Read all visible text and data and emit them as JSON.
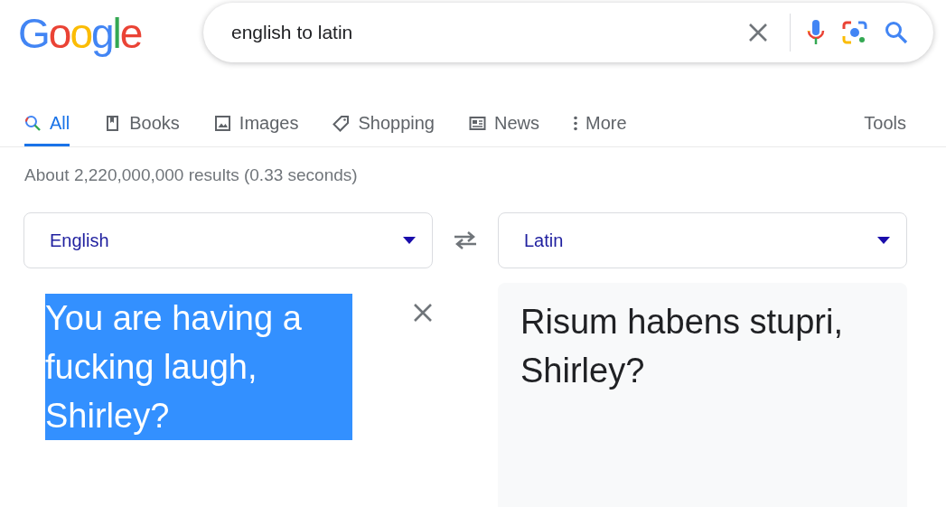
{
  "logo": {
    "text": "Google"
  },
  "search": {
    "value": "english to latin"
  },
  "tabs": [
    {
      "label": "All",
      "kind": "search",
      "selected": true
    },
    {
      "label": "Books",
      "kind": "book",
      "selected": false
    },
    {
      "label": "Images",
      "kind": "image",
      "selected": false
    },
    {
      "label": "Shopping",
      "kind": "tag",
      "selected": false
    },
    {
      "label": "News",
      "kind": "news",
      "selected": false
    },
    {
      "label": "More",
      "kind": "dots",
      "selected": false
    }
  ],
  "tools": "Tools",
  "result_stats": "About 2,220,000,000 results (0.33 seconds)",
  "translator": {
    "source_language": "English",
    "target_language": "Latin",
    "source_text": {
      "text": "You are having a fucking laugh, Shirley?",
      "selected": true
    },
    "translation": "Risum habens stupri, Shirley?"
  }
}
